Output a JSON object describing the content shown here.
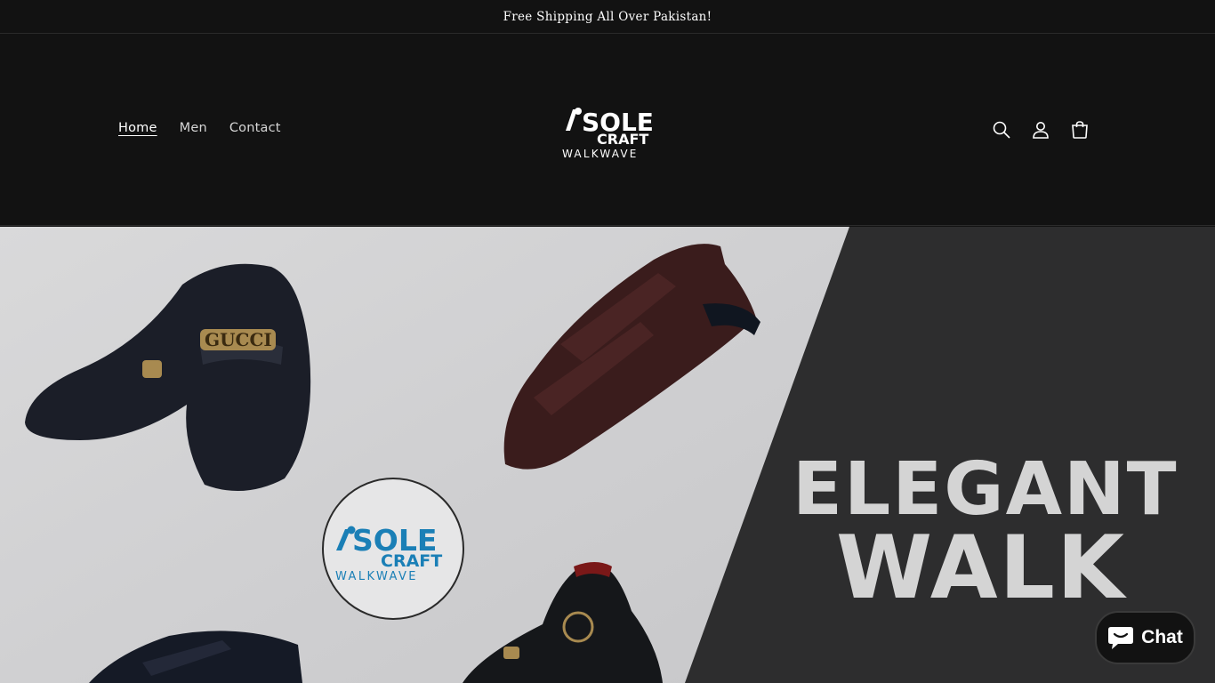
{
  "announcement": {
    "text": "Free Shipping All Over Pakistan!"
  },
  "header": {
    "nav": [
      {
        "label": "Home",
        "active": true
      },
      {
        "label": "Men",
        "active": false
      },
      {
        "label": "Contact",
        "active": false
      }
    ],
    "logo": {
      "line1": "SOLE",
      "line2": "CRAFT",
      "line3": "WALKWAVE"
    },
    "icons": [
      "search-icon",
      "account-icon",
      "cart-icon"
    ]
  },
  "hero": {
    "headline_1": "ELEGANT",
    "headline_2": "WALK",
    "badge": {
      "line1": "SOLE",
      "line2": "CRAFT",
      "line3": "WALKWAVE"
    },
    "product_emblem": "GUCCI"
  },
  "chat": {
    "label": "Chat"
  },
  "colors": {
    "background": "#121212",
    "hero_light": "#d4d4d6",
    "hero_dark": "#2c2c2c",
    "badge_accent": "#1a7fb6"
  }
}
